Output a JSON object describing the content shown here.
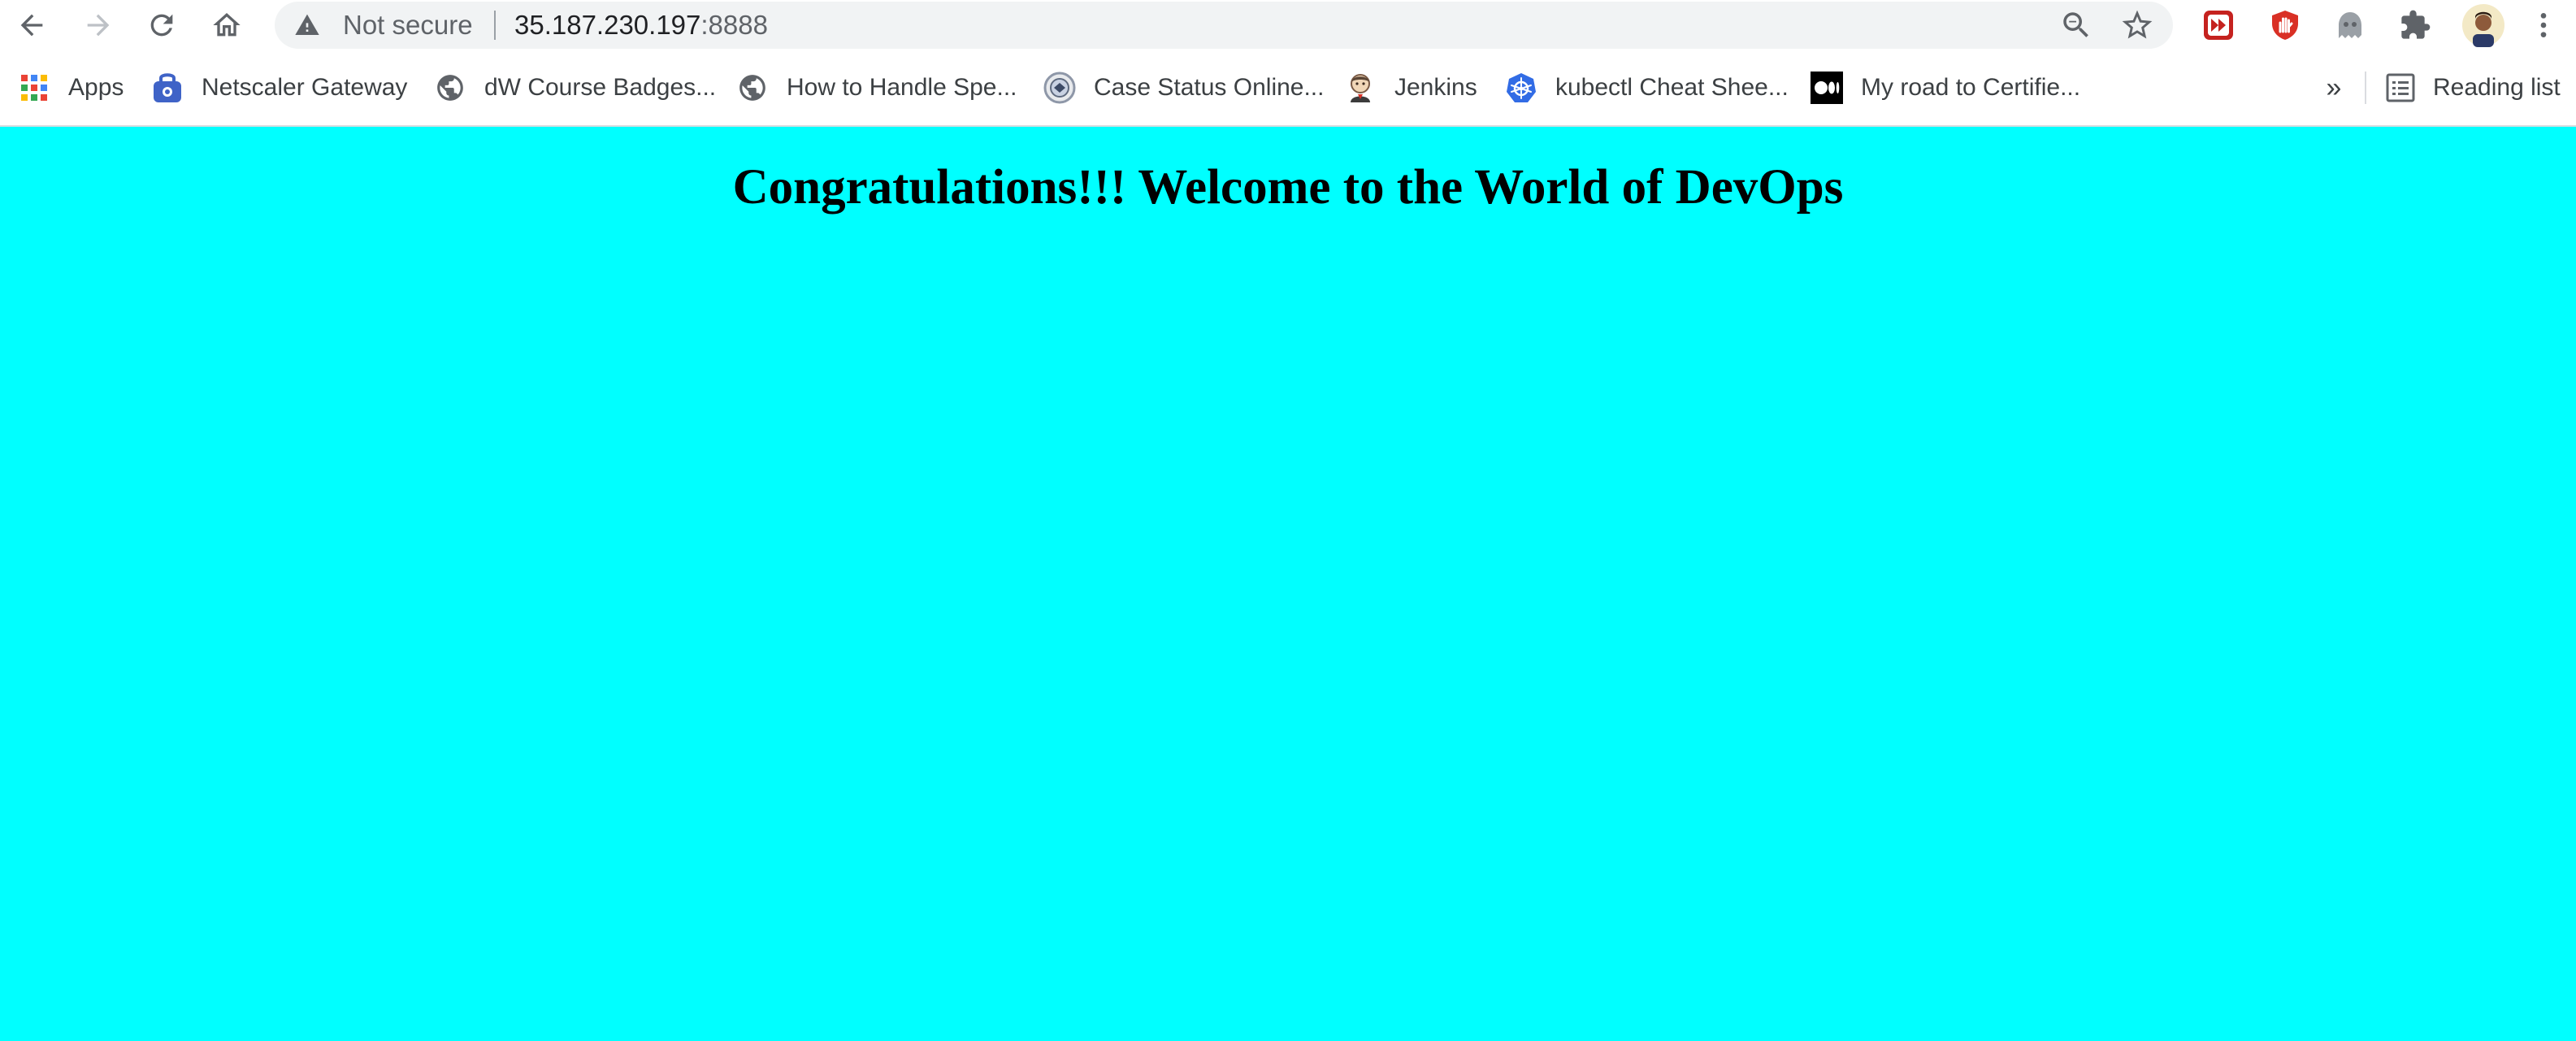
{
  "toolbar": {
    "security_label": "Not secure",
    "url_host": "35.187.230.197",
    "url_port": ":8888"
  },
  "bookmarks": {
    "items": [
      {
        "label": "Apps",
        "icon": "apps-grid-icon"
      },
      {
        "label": "Netscaler Gateway",
        "icon": "netscaler-icon"
      },
      {
        "label": "dW Course Badges...",
        "icon": "globe-icon"
      },
      {
        "label": "How to Handle Spe...",
        "icon": "globe-icon"
      },
      {
        "label": "Case Status Online...",
        "icon": "uscis-seal-icon"
      },
      {
        "label": "Jenkins",
        "icon": "jenkins-icon"
      },
      {
        "label": "kubectl Cheat Shee...",
        "icon": "kubernetes-icon"
      },
      {
        "label": "My road to Certifie...",
        "icon": "medium-icon"
      }
    ],
    "overflow_label": "»",
    "reading_list_label": "Reading list"
  },
  "page": {
    "heading": "Congratulations!!! Welcome to the World of DevOps",
    "background_color": "#00ffff"
  }
}
